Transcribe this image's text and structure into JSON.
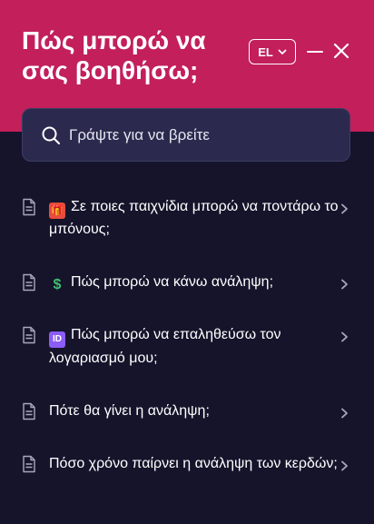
{
  "header": {
    "title": "Πώς μπορώ να σας βοηθήσω;",
    "language": "EL",
    "accent_color": "#c21f5b"
  },
  "search": {
    "placeholder": "Γράψτε για να βρείτε"
  },
  "articles": [
    {
      "icon": "gift-emoji",
      "emoji_label": "🎁",
      "text": "Σε ποιες παιχνίδια μπορώ να ποντάρω το μπόνους;"
    },
    {
      "icon": "dollar-emoji",
      "emoji_label": "$",
      "text": "Πώς μπορώ να κάνω ανάληψη;"
    },
    {
      "icon": "id-emoji",
      "emoji_label": "ID",
      "text": "Πώς μπορώ να επαληθεύσω τον λογαριασμό μου;"
    },
    {
      "icon": "",
      "emoji_label": "",
      "text": "Πότε θα γίνει η ανάληψη;"
    },
    {
      "icon": "",
      "emoji_label": "",
      "text": "Πόσο χρόνο παίρνει η ανάληψη των κερδών;"
    }
  ],
  "colors": {
    "background": "#15142b",
    "search_bg": "#2b2a4e",
    "icon_gray": "#a8a8bc"
  }
}
